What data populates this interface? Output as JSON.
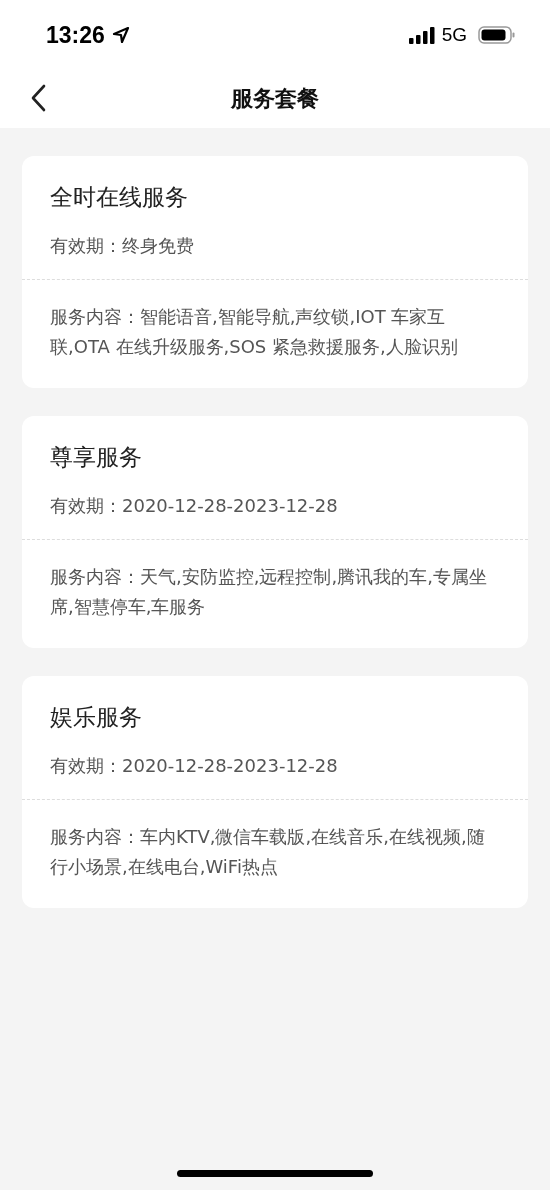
{
  "status_bar": {
    "time": "13:26",
    "network": "5G"
  },
  "nav": {
    "title": "服务套餐"
  },
  "packages": [
    {
      "name": "全时在线服务",
      "validity": "有效期：终身免费",
      "content": "服务内容：智能语音,智能导航,声纹锁,IOT 车家互联,OTA 在线升级服务,SOS 紧急救援服务,人脸识别"
    },
    {
      "name": "尊享服务",
      "validity": "有效期：2020-12-28-2023-12-28",
      "content": "服务内容：天气,安防监控,远程控制,腾讯我的车,专属坐席,智慧停车,车服务"
    },
    {
      "name": "娱乐服务",
      "validity": "有效期：2020-12-28-2023-12-28",
      "content": "服务内容：车内KTV,微信车载版,在线音乐,在线视频,随行小场景,在线电台,WiFi热点"
    }
  ]
}
